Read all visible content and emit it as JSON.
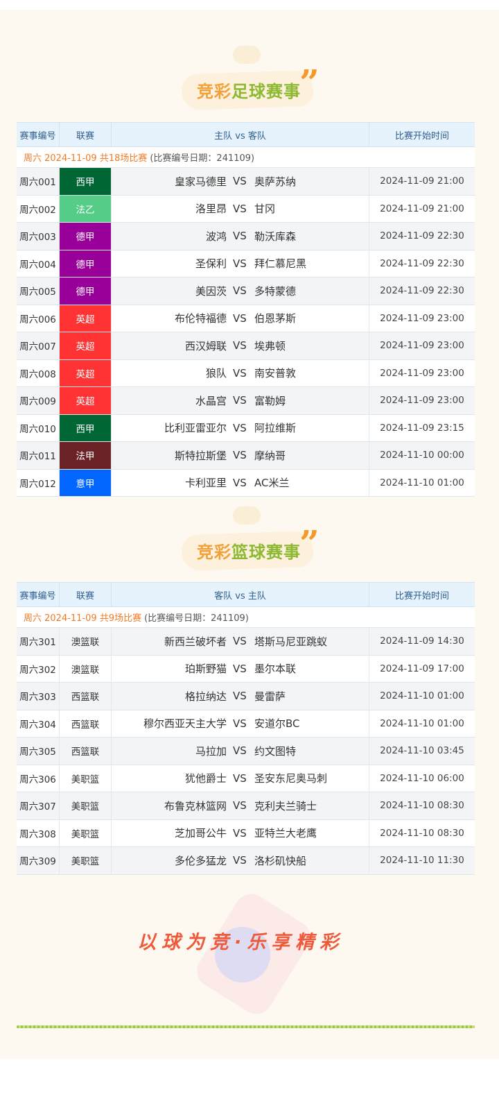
{
  "football": {
    "title_part1": "竞彩",
    "title_part2": "足球赛事",
    "quote_mark": "”",
    "header": {
      "id": "赛事编号",
      "league": "联赛",
      "teams": "主队 vs 客队",
      "time": "比赛开始时间"
    },
    "info_highlight": "周六 2024-11-09 共18场比赛",
    "info_gray": "(比赛编号日期：241109)",
    "rows": [
      {
        "id": "周六001",
        "league": "西甲",
        "color": "#006633",
        "home": "皇家马德里",
        "vs": "VS",
        "away": "奥萨苏纳",
        "time": "2024-11-09 21:00"
      },
      {
        "id": "周六002",
        "league": "法乙",
        "color": "#55cc88",
        "home": "洛里昂",
        "vs": "VS",
        "away": "甘冈",
        "time": "2024-11-09 21:00"
      },
      {
        "id": "周六003",
        "league": "德甲",
        "color": "#990099",
        "home": "波鸿",
        "vs": "VS",
        "away": "勒沃库森",
        "time": "2024-11-09 22:30"
      },
      {
        "id": "周六004",
        "league": "德甲",
        "color": "#990099",
        "home": "圣保利",
        "vs": "VS",
        "away": "拜仁慕尼黑",
        "time": "2024-11-09 22:30"
      },
      {
        "id": "周六005",
        "league": "德甲",
        "color": "#990099",
        "home": "美因茨",
        "vs": "VS",
        "away": "多特蒙德",
        "time": "2024-11-09 22:30"
      },
      {
        "id": "周六006",
        "league": "英超",
        "color": "#ff3333",
        "home": "布伦特福德",
        "vs": "VS",
        "away": "伯恩茅斯",
        "time": "2024-11-09 23:00"
      },
      {
        "id": "周六007",
        "league": "英超",
        "color": "#ff3333",
        "home": "西汉姆联",
        "vs": "VS",
        "away": "埃弗顿",
        "time": "2024-11-09 23:00"
      },
      {
        "id": "周六008",
        "league": "英超",
        "color": "#ff3333",
        "home": "狼队",
        "vs": "VS",
        "away": "南安普敦",
        "time": "2024-11-09 23:00"
      },
      {
        "id": "周六009",
        "league": "英超",
        "color": "#ff3333",
        "home": "水晶宫",
        "vs": "VS",
        "away": "富勒姆",
        "time": "2024-11-09 23:00"
      },
      {
        "id": "周六010",
        "league": "西甲",
        "color": "#006633",
        "home": "比利亚雷亚尔",
        "vs": "VS",
        "away": "阿拉维斯",
        "time": "2024-11-09 23:15"
      },
      {
        "id": "周六011",
        "league": "法甲",
        "color": "#6a2226",
        "home": "斯特拉斯堡",
        "vs": "VS",
        "away": "摩纳哥",
        "time": "2024-11-10 00:00"
      },
      {
        "id": "周六012",
        "league": "意甲",
        "color": "#0066ff",
        "home": "卡利亚里",
        "vs": "VS",
        "away": "AC米兰",
        "time": "2024-11-10 01:00"
      }
    ]
  },
  "basketball": {
    "title_part1": "竞彩",
    "title_part2": "篮球赛事",
    "quote_mark": "”",
    "header": {
      "id": "赛事编号",
      "league": "联赛",
      "teams": "客队 vs 主队",
      "time": "比赛开始时间"
    },
    "info_highlight": "周六 2024-11-09 共9场比赛",
    "info_gray": "(比赛编号日期：241109)",
    "rows": [
      {
        "id": "周六301",
        "league": "澳篮联",
        "home": "新西兰破坏者",
        "vs": "VS",
        "away": "塔斯马尼亚跳蚁",
        "time": "2024-11-09 14:30"
      },
      {
        "id": "周六302",
        "league": "澳篮联",
        "home": "珀斯野猫",
        "vs": "VS",
        "away": "墨尔本联",
        "time": "2024-11-09 17:00"
      },
      {
        "id": "周六303",
        "league": "西篮联",
        "home": "格拉纳达",
        "vs": "VS",
        "away": "曼雷萨",
        "time": "2024-11-10 01:00"
      },
      {
        "id": "周六304",
        "league": "西篮联",
        "home": "穆尔西亚天主大学",
        "vs": "VS",
        "away": "安道尔BC",
        "time": "2024-11-10 01:00"
      },
      {
        "id": "周六305",
        "league": "西篮联",
        "home": "马拉加",
        "vs": "VS",
        "away": "约文图特",
        "time": "2024-11-10 03:45"
      },
      {
        "id": "周六306",
        "league": "美职篮",
        "home": "犹他爵士",
        "vs": "VS",
        "away": "圣安东尼奥马刺",
        "time": "2024-11-10 06:00"
      },
      {
        "id": "周六307",
        "league": "美职篮",
        "home": "布鲁克林篮网",
        "vs": "VS",
        "away": "克利夫兰骑士",
        "time": "2024-11-10 08:30"
      },
      {
        "id": "周六308",
        "league": "美职篮",
        "home": "芝加哥公牛",
        "vs": "VS",
        "away": "亚特兰大老鹰",
        "time": "2024-11-10 08:30"
      },
      {
        "id": "周六309",
        "league": "美职篮",
        "home": "多伦多猛龙",
        "vs": "VS",
        "away": "洛杉矶快船",
        "time": "2024-11-10 11:30"
      }
    ]
  },
  "slogan": "以球为竞·乐享精彩"
}
